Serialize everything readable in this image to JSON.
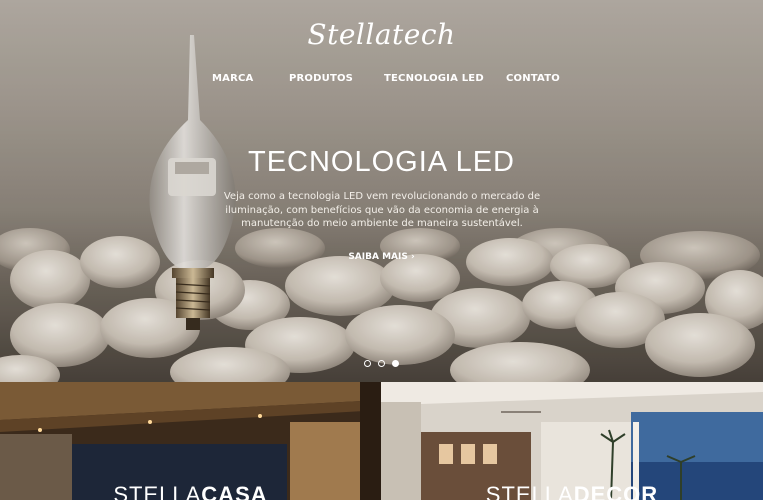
{
  "brand": {
    "logo_text": "Stellatech"
  },
  "nav": {
    "items": [
      "MARCA",
      "PRODUTOS",
      "TECNOLOGIA LED",
      "CONTATO"
    ]
  },
  "hero": {
    "title": "TECNOLOGIA LED",
    "description": "Veja como a tecnologia LED vem revolucionando o mercado de iluminação, com benefícios que vão da economia de energia à manutenção do meio ambiente de maneira sustentável.",
    "cta": "SAIBA MAIS ›",
    "slider": {
      "count": 3,
      "active_index": 2
    }
  },
  "cards": [
    {
      "light": "STELLA",
      "bold": "CASA"
    },
    {
      "light": "STELLA",
      "bold": "DECOR"
    }
  ]
}
